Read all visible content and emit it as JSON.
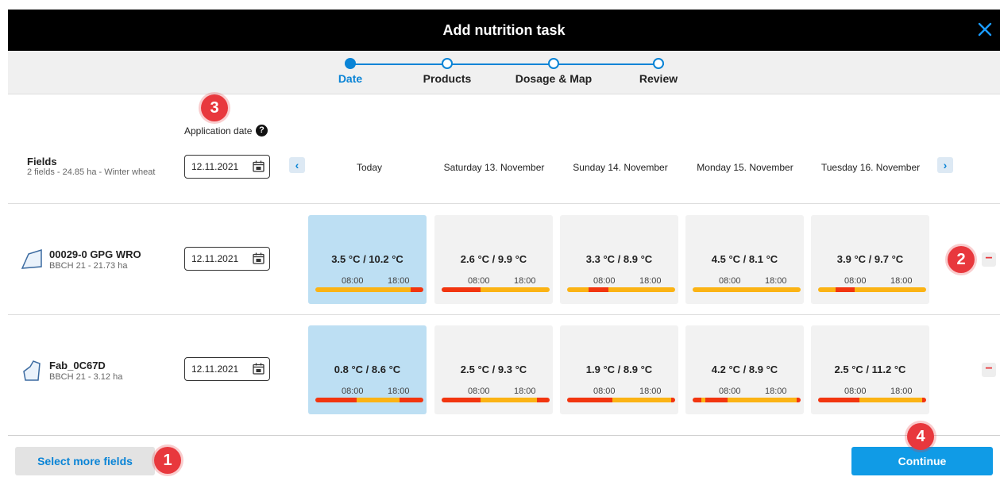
{
  "dialog": {
    "title": "Add nutrition task"
  },
  "steps": [
    {
      "label": "Date",
      "active": true
    },
    {
      "label": "Products",
      "active": false
    },
    {
      "label": "Dosage & Map",
      "active": false
    },
    {
      "label": "Review",
      "active": false
    }
  ],
  "header_row": {
    "application_date_label": "Application date",
    "help_glyph": "?",
    "fields_title": "Fields",
    "fields_summary": "2 fields - 24.85 ha - Winter wheat",
    "application_date_value": "12.11.2021",
    "prev_glyph": "‹",
    "next_glyph": "›",
    "days": [
      "Today",
      "Saturday 13. November",
      "Sunday 14. November",
      "Monday 15. November",
      "Tuesday 16. November"
    ]
  },
  "fields": [
    {
      "name": "00029-0 GPG WRO",
      "details": "BBCH 21 - 21.73 ha",
      "date": "12.11.2021",
      "remove_glyph": "−",
      "forecast": [
        {
          "temp": "3.5 °C / 10.2 °C",
          "am": "08:00",
          "pm": "18:00",
          "bar": [
            [
              "y",
              88
            ],
            [
              "r",
              12
            ]
          ]
        },
        {
          "temp": "2.6 °C / 9.9 °C",
          "am": "08:00",
          "pm": "18:00",
          "bar": [
            [
              "r",
              36
            ],
            [
              "y",
              64
            ]
          ]
        },
        {
          "temp": "3.3 °C / 8.9 °C",
          "am": "08:00",
          "pm": "18:00",
          "bar": [
            [
              "y",
              20
            ],
            [
              "r",
              18
            ],
            [
              "y",
              62
            ]
          ]
        },
        {
          "temp": "4.5 °C / 8.1 °C",
          "am": "08:00",
          "pm": "18:00",
          "bar": [
            [
              "y",
              100
            ]
          ]
        },
        {
          "temp": "3.9 °C / 9.7 °C",
          "am": "08:00",
          "pm": "18:00",
          "bar": [
            [
              "y",
              16
            ],
            [
              "r",
              18
            ],
            [
              "y",
              66
            ]
          ]
        }
      ]
    },
    {
      "name": "Fab_0C67D",
      "details": "BBCH 21 - 3.12 ha",
      "date": "12.11.2021",
      "remove_glyph": "−",
      "forecast": [
        {
          "temp": "0.8 °C / 8.6 °C",
          "am": "08:00",
          "pm": "18:00",
          "bar": [
            [
              "r",
              38
            ],
            [
              "y",
              40
            ],
            [
              "r",
              22
            ]
          ]
        },
        {
          "temp": "2.5 °C / 9.3 °C",
          "am": "08:00",
          "pm": "18:00",
          "bar": [
            [
              "r",
              36
            ],
            [
              "y",
              52
            ],
            [
              "r",
              12
            ]
          ]
        },
        {
          "temp": "1.9 °C / 8.9 °C",
          "am": "08:00",
          "pm": "18:00",
          "bar": [
            [
              "r",
              42
            ],
            [
              "y",
              54
            ],
            [
              "r",
              4
            ]
          ]
        },
        {
          "temp": "4.2 °C / 8.9 °C",
          "am": "08:00",
          "pm": "18:00",
          "bar": [
            [
              "r",
              8
            ],
            [
              "y",
              4
            ],
            [
              "r",
              20
            ],
            [
              "y",
              64
            ],
            [
              "r",
              4
            ]
          ]
        },
        {
          "temp": "2.5 °C / 11.2 °C",
          "am": "08:00",
          "pm": "18:00",
          "bar": [
            [
              "r",
              38
            ],
            [
              "y",
              58
            ],
            [
              "r",
              4
            ]
          ]
        }
      ]
    }
  ],
  "footer": {
    "select_more_label": "Select more fields",
    "continue_label": "Continue"
  },
  "markers": [
    "1",
    "2",
    "3",
    "4"
  ],
  "colors": {
    "accent": "#0a84d6",
    "warning": "#fbb314",
    "danger": "#f2350f",
    "marker": "#e8383d",
    "today_card": "#bddff3"
  }
}
